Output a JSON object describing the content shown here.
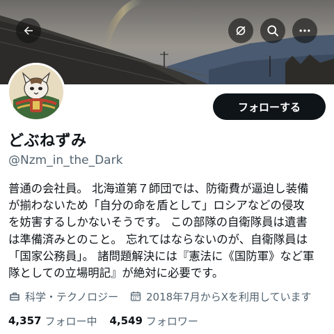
{
  "header": {
    "back_icon": "arrow-left-icon",
    "actions": [
      "mute-slash-icon",
      "search-icon",
      "more-icon"
    ]
  },
  "profile": {
    "display_name": "どぶねずみ",
    "handle": "@Nzm_in_the_Dark",
    "follow_label": "フォローする",
    "bio_lines": [
      "普通の会社員。 北海道第７師団では、防衛費が逼迫し装備",
      "が揃わないため「自分の命を盾として」ロシアなどの侵攻",
      "を妨害するしかないそうです。 この部隊の自衛隊員は遺書",
      "は準備済みとのこと。 忘れてはならないのが、自衛隊員は",
      "「国家公務員」。 諸問題解決には『憲法に《国防軍》など軍",
      "隊としての立場明記』が絶対に必要です。"
    ],
    "category": "科学・テクノロジー",
    "joined": "2018年7月からXを利用しています",
    "following_count": "4,357",
    "following_label": "フォロー中",
    "followers_count": "4,549",
    "followers_label": "フォロワー"
  },
  "colors": {
    "text": "#0f1419",
    "muted": "#536471",
    "button_bg": "#0f1419",
    "button_text": "#ffffff"
  }
}
